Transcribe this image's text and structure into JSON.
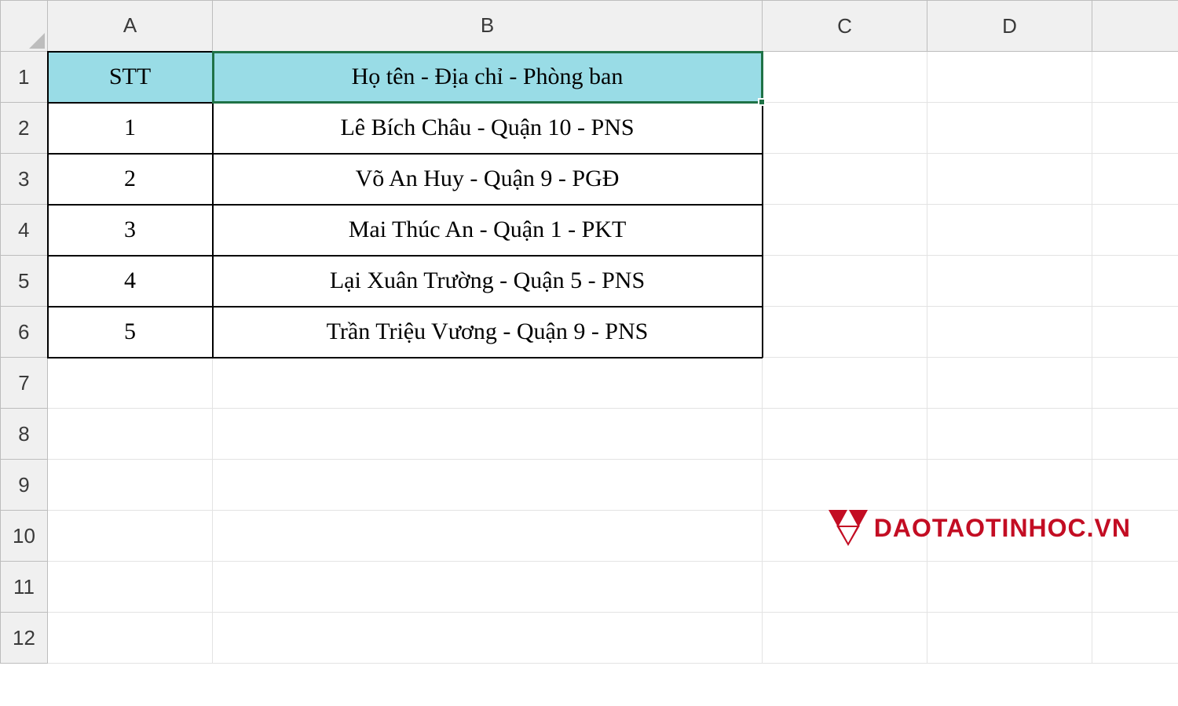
{
  "columns": [
    "A",
    "B",
    "C",
    "D"
  ],
  "rowCount": 12,
  "headerRow": {
    "A": "STT",
    "B": "Họ tên - Địa chỉ - Phòng ban"
  },
  "rows": [
    {
      "A": "1",
      "B": "Lê Bích Châu - Quận 10 - PNS"
    },
    {
      "A": "2",
      "B": "Võ An Huy - Quận 9 - PGĐ"
    },
    {
      "A": "3",
      "B": "Mai Thúc An - Quận 1 - PKT"
    },
    {
      "A": "4",
      "B": "Lại Xuân Trường - Quận 5 - PNS"
    },
    {
      "A": "5",
      "B": "Trần Triệu Vương - Quận 9 - PNS"
    }
  ],
  "activeCell": "B1",
  "watermark": "DAOTAOTINHOC.VN",
  "colWidths": {
    "A": 210,
    "B": 700,
    "C": 210,
    "D": 210
  }
}
